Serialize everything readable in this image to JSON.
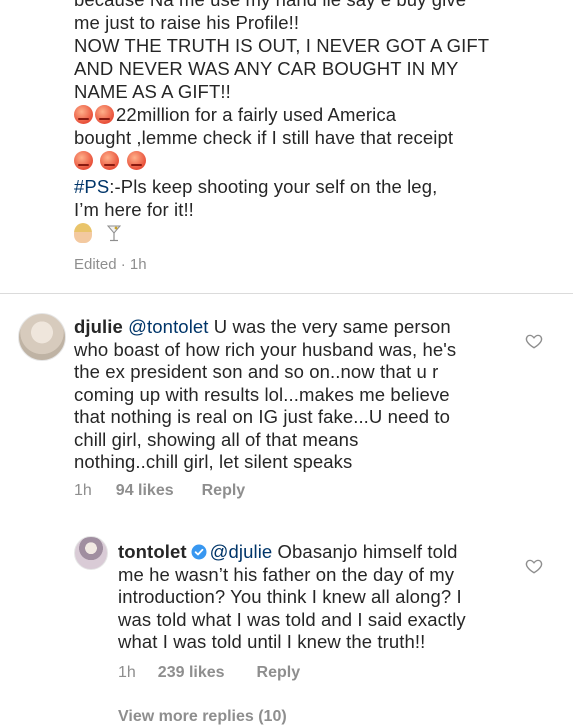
{
  "caption": {
    "line1": "because Na me use my hand lie say e buy give",
    "line2": "me just to raise his Profile!!",
    "line3": "NOW THE TRUTH IS OUT, I NEVER GOT A GIFT",
    "line4": "AND NEVER WAS ANY CAR BOUGHT IN MY",
    "line5": "NAME AS A GIFT!!",
    "line6": "22million for a fairly used America",
    "line7": "bought ,lemme check if I still have that receipt",
    "hashtag": "#PS",
    "line9_rest": ":-Pls keep shooting your self on the leg,",
    "line10": "I’m here for it!!",
    "edited_label": "Edited · 1h"
  },
  "comment1": {
    "username": "djulie",
    "mention": "@tontolet",
    "line1_rest": " U was the very same person",
    "line2": "who boast of how rich your husband was, he's",
    "line3": "the ex president son and so on..now that u r",
    "line4": "coming up with results lol...makes me believe",
    "line5": "that nothing is real on IG just fake...U need to",
    "line6": "chill girl, showing all of that means",
    "line7": "nothing..chill girl, let silent speaks",
    "time": "1h",
    "likes": "94 likes",
    "reply": "Reply",
    "icons": {
      "heart": "heart-outline-icon"
    }
  },
  "reply1": {
    "username": "tontolet",
    "mention": "@djulie",
    "line1_rest": " Obasanjo himself told",
    "line2": "me he wasn’t his father on the day of my",
    "line3": "introduction? You think I knew all along? I",
    "line4": "was told what I was told and I said exactly",
    "line5": "what I was told until I knew the truth!!",
    "time": "1h",
    "likes": "239 likes",
    "reply": "Reply",
    "verified_color": "#3897f0"
  },
  "view_more": "View more replies (10)",
  "colors": {
    "text": "#262626",
    "muted": "#8e8e8e",
    "link": "#003569",
    "divider": "#dbdbdb"
  }
}
